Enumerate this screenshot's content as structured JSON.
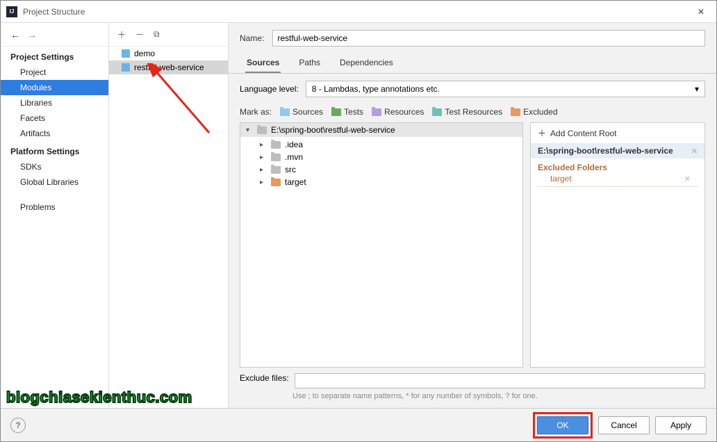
{
  "window": {
    "title": "Project Structure"
  },
  "left": {
    "section1": "Project Settings",
    "items1": [
      "Project",
      "Modules",
      "Libraries",
      "Facets",
      "Artifacts"
    ],
    "selected1": "Modules",
    "section2": "Platform Settings",
    "items2": [
      "SDKs",
      "Global Libraries"
    ],
    "section3_item": "Problems"
  },
  "modules": {
    "list": [
      "demo",
      "restful-web-service"
    ],
    "selected": "restful-web-service"
  },
  "form": {
    "name_label": "Name:",
    "name_value": "restful-web-service",
    "tabs": [
      "Sources",
      "Paths",
      "Dependencies"
    ],
    "active_tab": "Sources",
    "lang_label": "Language level:",
    "lang_value": "8 - Lambdas, type annotations etc.",
    "mark_label": "Mark as:",
    "marks": [
      "Sources",
      "Tests",
      "Resources",
      "Test Resources",
      "Excluded"
    ],
    "tree_root": "E:\\spring-boot\\restful-web-service",
    "tree_items": [
      {
        "name": ".idea",
        "color": "gray"
      },
      {
        "name": ".mvn",
        "color": "gray"
      },
      {
        "name": "src",
        "color": "gray"
      },
      {
        "name": "target",
        "color": "orange"
      }
    ],
    "add_root": "Add Content Root",
    "root_path": "E:\\spring-boot\\restful-web-service",
    "excluded_header": "Excluded Folders",
    "excluded_items": [
      "target"
    ],
    "exclude_label": "Exclude files:",
    "exclude_hint": "Use ; to separate name patterns, * for any number of symbols, ? for one."
  },
  "footer": {
    "ok": "OK",
    "cancel": "Cancel",
    "apply": "Apply"
  },
  "watermark": "blogchiasekienthuc.com"
}
